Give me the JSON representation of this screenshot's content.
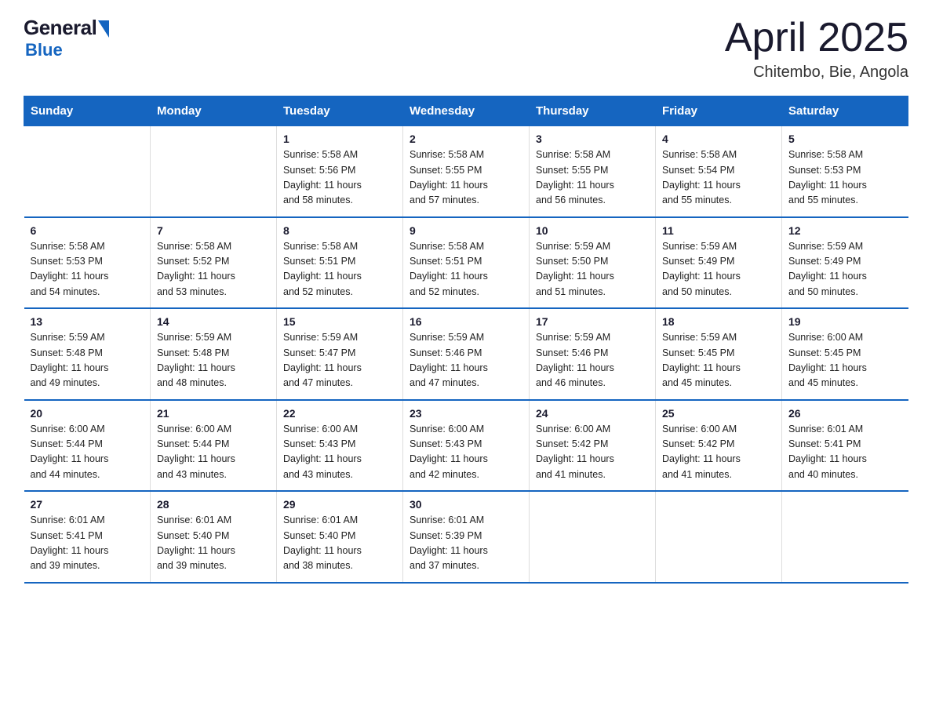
{
  "header": {
    "logo_general": "General",
    "logo_blue": "Blue",
    "month_title": "April 2025",
    "location": "Chitembo, Bie, Angola"
  },
  "weekdays": [
    "Sunday",
    "Monday",
    "Tuesday",
    "Wednesday",
    "Thursday",
    "Friday",
    "Saturday"
  ],
  "weeks": [
    [
      {
        "day": "",
        "info": ""
      },
      {
        "day": "",
        "info": ""
      },
      {
        "day": "1",
        "info": "Sunrise: 5:58 AM\nSunset: 5:56 PM\nDaylight: 11 hours\nand 58 minutes."
      },
      {
        "day": "2",
        "info": "Sunrise: 5:58 AM\nSunset: 5:55 PM\nDaylight: 11 hours\nand 57 minutes."
      },
      {
        "day": "3",
        "info": "Sunrise: 5:58 AM\nSunset: 5:55 PM\nDaylight: 11 hours\nand 56 minutes."
      },
      {
        "day": "4",
        "info": "Sunrise: 5:58 AM\nSunset: 5:54 PM\nDaylight: 11 hours\nand 55 minutes."
      },
      {
        "day": "5",
        "info": "Sunrise: 5:58 AM\nSunset: 5:53 PM\nDaylight: 11 hours\nand 55 minutes."
      }
    ],
    [
      {
        "day": "6",
        "info": "Sunrise: 5:58 AM\nSunset: 5:53 PM\nDaylight: 11 hours\nand 54 minutes."
      },
      {
        "day": "7",
        "info": "Sunrise: 5:58 AM\nSunset: 5:52 PM\nDaylight: 11 hours\nand 53 minutes."
      },
      {
        "day": "8",
        "info": "Sunrise: 5:58 AM\nSunset: 5:51 PM\nDaylight: 11 hours\nand 52 minutes."
      },
      {
        "day": "9",
        "info": "Sunrise: 5:58 AM\nSunset: 5:51 PM\nDaylight: 11 hours\nand 52 minutes."
      },
      {
        "day": "10",
        "info": "Sunrise: 5:59 AM\nSunset: 5:50 PM\nDaylight: 11 hours\nand 51 minutes."
      },
      {
        "day": "11",
        "info": "Sunrise: 5:59 AM\nSunset: 5:49 PM\nDaylight: 11 hours\nand 50 minutes."
      },
      {
        "day": "12",
        "info": "Sunrise: 5:59 AM\nSunset: 5:49 PM\nDaylight: 11 hours\nand 50 minutes."
      }
    ],
    [
      {
        "day": "13",
        "info": "Sunrise: 5:59 AM\nSunset: 5:48 PM\nDaylight: 11 hours\nand 49 minutes."
      },
      {
        "day": "14",
        "info": "Sunrise: 5:59 AM\nSunset: 5:48 PM\nDaylight: 11 hours\nand 48 minutes."
      },
      {
        "day": "15",
        "info": "Sunrise: 5:59 AM\nSunset: 5:47 PM\nDaylight: 11 hours\nand 47 minutes."
      },
      {
        "day": "16",
        "info": "Sunrise: 5:59 AM\nSunset: 5:46 PM\nDaylight: 11 hours\nand 47 minutes."
      },
      {
        "day": "17",
        "info": "Sunrise: 5:59 AM\nSunset: 5:46 PM\nDaylight: 11 hours\nand 46 minutes."
      },
      {
        "day": "18",
        "info": "Sunrise: 5:59 AM\nSunset: 5:45 PM\nDaylight: 11 hours\nand 45 minutes."
      },
      {
        "day": "19",
        "info": "Sunrise: 6:00 AM\nSunset: 5:45 PM\nDaylight: 11 hours\nand 45 minutes."
      }
    ],
    [
      {
        "day": "20",
        "info": "Sunrise: 6:00 AM\nSunset: 5:44 PM\nDaylight: 11 hours\nand 44 minutes."
      },
      {
        "day": "21",
        "info": "Sunrise: 6:00 AM\nSunset: 5:44 PM\nDaylight: 11 hours\nand 43 minutes."
      },
      {
        "day": "22",
        "info": "Sunrise: 6:00 AM\nSunset: 5:43 PM\nDaylight: 11 hours\nand 43 minutes."
      },
      {
        "day": "23",
        "info": "Sunrise: 6:00 AM\nSunset: 5:43 PM\nDaylight: 11 hours\nand 42 minutes."
      },
      {
        "day": "24",
        "info": "Sunrise: 6:00 AM\nSunset: 5:42 PM\nDaylight: 11 hours\nand 41 minutes."
      },
      {
        "day": "25",
        "info": "Sunrise: 6:00 AM\nSunset: 5:42 PM\nDaylight: 11 hours\nand 41 minutes."
      },
      {
        "day": "26",
        "info": "Sunrise: 6:01 AM\nSunset: 5:41 PM\nDaylight: 11 hours\nand 40 minutes."
      }
    ],
    [
      {
        "day": "27",
        "info": "Sunrise: 6:01 AM\nSunset: 5:41 PM\nDaylight: 11 hours\nand 39 minutes."
      },
      {
        "day": "28",
        "info": "Sunrise: 6:01 AM\nSunset: 5:40 PM\nDaylight: 11 hours\nand 39 minutes."
      },
      {
        "day": "29",
        "info": "Sunrise: 6:01 AM\nSunset: 5:40 PM\nDaylight: 11 hours\nand 38 minutes."
      },
      {
        "day": "30",
        "info": "Sunrise: 6:01 AM\nSunset: 5:39 PM\nDaylight: 11 hours\nand 37 minutes."
      },
      {
        "day": "",
        "info": ""
      },
      {
        "day": "",
        "info": ""
      },
      {
        "day": "",
        "info": ""
      }
    ]
  ]
}
